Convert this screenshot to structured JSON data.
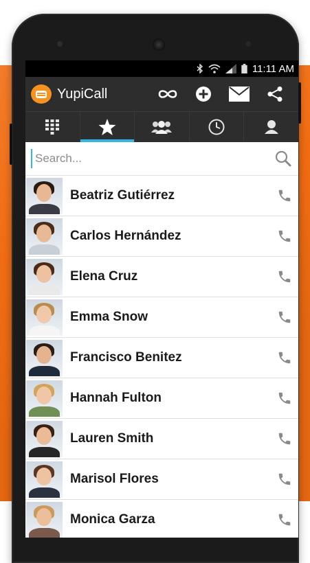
{
  "status": {
    "time": "11:11 AM"
  },
  "app": {
    "title": "YupiCall"
  },
  "search": {
    "placeholder": "Search..."
  },
  "contacts": [
    {
      "name": "Beatriz Gutiérrez",
      "skin": "#e8b894",
      "hair": "#2a1a12",
      "shirt": "#3b3b46"
    },
    {
      "name": "Carlos Hernández",
      "skin": "#e9b996",
      "hair": "#4a2c1a",
      "shirt": "#c9cfd6"
    },
    {
      "name": "Elena Cruz",
      "skin": "#eec1a0",
      "hair": "#4b2b18",
      "shirt": "#e9e9e9"
    },
    {
      "name": "Emma Snow",
      "skin": "#f0c9ab",
      "hair": "#b88c4d",
      "shirt": "#f5f5f5"
    },
    {
      "name": "Francisco Benitez",
      "skin": "#e6b390",
      "hair": "#2a1d14",
      "shirt": "#1f2a3a"
    },
    {
      "name": "Hannah Fulton",
      "skin": "#efc7a6",
      "hair": "#d0a558",
      "shirt": "#6f8f55"
    },
    {
      "name": "Lauren Smith",
      "skin": "#ebbb98",
      "hair": "#3a2013",
      "shirt": "#262626"
    },
    {
      "name": "Marisol Flores",
      "skin": "#eec3a2",
      "hair": "#5b3620",
      "shirt": "#2c3140"
    },
    {
      "name": "Monica Garza",
      "skin": "#ecbf9c",
      "hair": "#c99a5a",
      "shirt": "#7a5a4a"
    }
  ]
}
